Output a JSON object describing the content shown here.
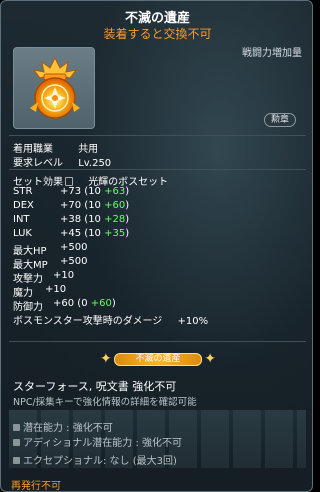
{
  "item": {
    "name": "不滅の遺産",
    "trade_note": "装着すると交換不可",
    "power_label": "戦闘力増加量",
    "medal_badge": "勲章",
    "icon": "golden-medal-icon"
  },
  "requirements": [
    {
      "label": "着用職業",
      "value": "共用"
    },
    {
      "label": "要求レベル",
      "value": "Lv.250"
    }
  ],
  "set_effect": {
    "label": "セット効果",
    "value": "光輝のボスセット"
  },
  "stats": [
    {
      "name": "STR",
      "total": "+73",
      "base": "(10",
      "bonus": "+63",
      "close": ")"
    },
    {
      "name": "DEX",
      "total": "+70",
      "base": "(10",
      "bonus": "+60",
      "close": ")"
    },
    {
      "name": "INT",
      "total": "+38",
      "base": "(10",
      "bonus": "+28",
      "close": ")"
    },
    {
      "name": "LUK",
      "total": "+45",
      "base": "(10",
      "bonus": "+35",
      "close": ")"
    }
  ],
  "other_stats": [
    {
      "name": "最大HP",
      "value": "+500"
    },
    {
      "name": "最大MP",
      "value": "+500"
    },
    {
      "name": "攻撃力",
      "value": "+10"
    },
    {
      "name": "魔力",
      "value": "+10"
    }
  ],
  "defense": {
    "name": "防御力",
    "total": "+60",
    "base": "(0",
    "bonus": "+60",
    "close": ")"
  },
  "boss_damage": {
    "name": "ボスモンスター攻撃時のダメージ",
    "value": "+10%"
  },
  "legacy_banner": "不滅の遺産",
  "star_force": "スターフォース, 呪文書 強化不可",
  "npc_note": "NPC/採集キーで強化情報の詳細を確認可能",
  "potentials": [
    {
      "text": "潜在能力 : 強化不可"
    },
    {
      "text": "アディショナル潜在能力 : 強化不可"
    },
    {
      "text": "エクセプショナル: なし (最大3回)"
    }
  ],
  "reissue": "再発行不可",
  "colors": {
    "accent_orange": "#ff9a2a",
    "bonus_green": "#66ff66"
  }
}
